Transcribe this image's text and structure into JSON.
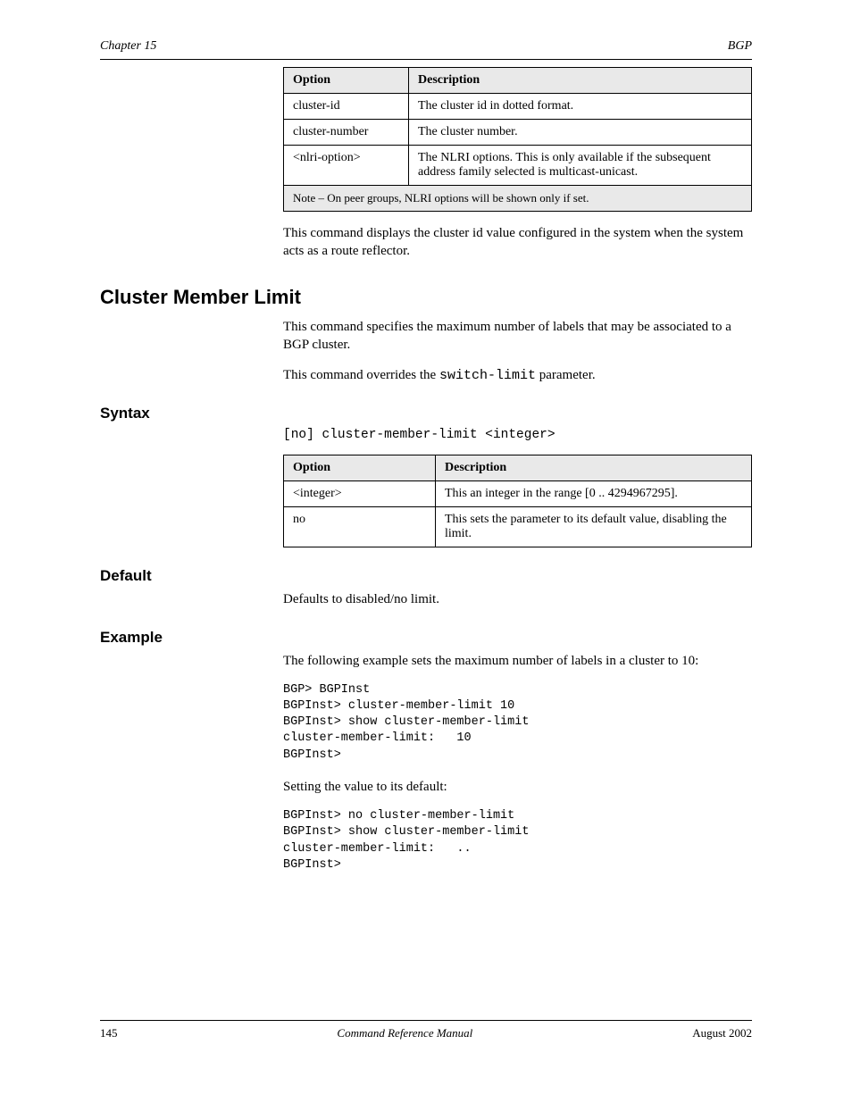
{
  "header": {
    "left": "Chapter 15",
    "right": "BGP"
  },
  "table1": {
    "headers": [
      "Option",
      "Description"
    ],
    "rows": [
      [
        "cluster-id",
        "The cluster id in dotted format."
      ],
      [
        "cluster-number",
        "The cluster number."
      ],
      [
        "<nlri-option>",
        "The NLRI options. This is only available if the subsequent address family selected is multicast-unicast."
      ]
    ],
    "note": "Note – On peer groups, NLRI options will be shown only if set."
  },
  "para_show_cluster": "This command displays the cluster id value configured in the system when the system acts as a route reflector.",
  "h2": "Cluster Member Limit",
  "para_cml_1": "This command specifies the maximum number of labels that may be associated to a BGP cluster.",
  "para_cml_2": {
    "pre": "This command overrides the ",
    "mono": "switch-limit",
    "post": " parameter."
  },
  "h3_syntax": "Syntax",
  "syntax_cml": "[no] cluster-member-limit <integer>",
  "table2": {
    "headers": [
      "Option",
      "Description"
    ],
    "rows": [
      [
        "<integer>",
        "This an integer in the range [0 .. 4294967295]."
      ],
      [
        "no",
        "This sets the parameter to its default value, disabling the limit."
      ]
    ]
  },
  "h3_default": "Default",
  "default_text": "Defaults to disabled/no limit.",
  "h3_example": "Example",
  "example_pre": "The following example sets the maximum number of labels in a cluster to 10:",
  "example_block": "BGP> BGPInst\nBGPInst> cluster-member-limit 10\nBGPInst> show cluster-member-limit\ncluster-member-limit:   10\nBGPInst>",
  "para_setdef_pre": "Setting the value to its default:",
  "example_block2": "BGPInst> no cluster-member-limit\nBGPInst> show cluster-member-limit\ncluster-member-limit:   ..\nBGPInst>",
  "footer": {
    "left": "145",
    "center": "Command Reference Manual",
    "right": "August 2002"
  }
}
